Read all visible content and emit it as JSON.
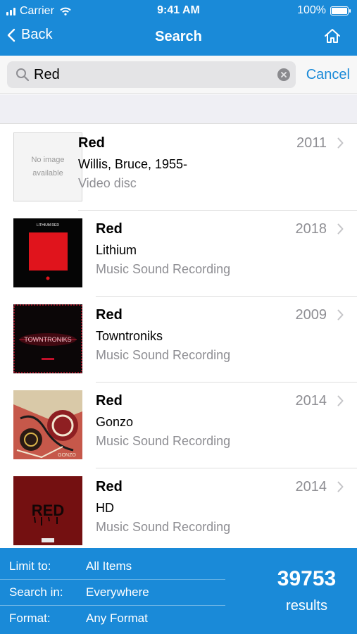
{
  "status": {
    "carrier": "Carrier",
    "time": "9:41 AM",
    "battery": "100%"
  },
  "nav": {
    "back_label": "Back",
    "title": "Search",
    "home_icon": "home-icon"
  },
  "search": {
    "query": "Red",
    "cancel_label": "Cancel"
  },
  "results": [
    {
      "title": "Red",
      "author": "Willis, Bruce, 1955-",
      "format": "Video disc",
      "year": "2011",
      "no_image": "No image available",
      "has_image": false
    },
    {
      "title": "Red",
      "author": "Lithium",
      "format": "Music Sound Recording",
      "year": "2018",
      "cover_text": "LITHIUM RED",
      "has_image": true
    },
    {
      "title": "Red",
      "author": "Towntroniks",
      "format": "Music Sound Recording",
      "year": "2009",
      "cover_text": "TOWNTRONIKS",
      "has_image": true
    },
    {
      "title": "Red",
      "author": "Gonzo",
      "format": "Music Sound Recording",
      "year": "2014",
      "cover_text": "GONZO",
      "has_image": true
    },
    {
      "title": "Red",
      "author": "HD",
      "format": "Music Sound Recording",
      "year": "2014",
      "cover_text": "RED",
      "has_image": true
    }
  ],
  "footer": {
    "filters": [
      {
        "label": "Limit to:",
        "value": "All Items"
      },
      {
        "label": "Search in:",
        "value": "Everywhere"
      },
      {
        "label": "Format:",
        "value": "Any Format"
      }
    ],
    "count": "39753",
    "count_label": "results"
  },
  "colors": {
    "accent": "#1a8ad8",
    "secondary_text": "#8e8e93",
    "separator": "#dedede"
  }
}
